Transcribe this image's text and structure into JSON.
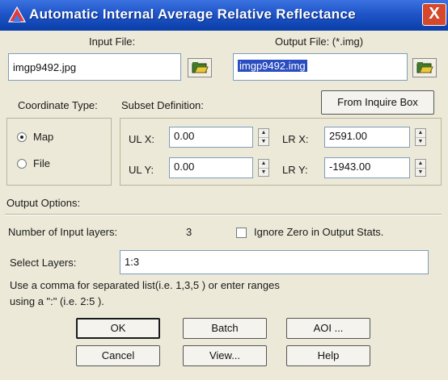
{
  "window": {
    "title": "Automatic Internal Average Relative Reflectance",
    "close_glyph": "X"
  },
  "input_file": {
    "label": "Input File:",
    "value": "imgp9492.jpg"
  },
  "output_file": {
    "label": "Output File: (*.img)",
    "value": "imgp9492.img"
  },
  "coordinate_type": {
    "label": "Coordinate Type:",
    "options": [
      "Map",
      "File"
    ],
    "selected": "Map"
  },
  "subset": {
    "label": "Subset Definition:",
    "from_inquire_box": "From Inquire Box",
    "ulx_label": "UL X:",
    "ulx_value": "0.00",
    "uly_label": "UL Y:",
    "uly_value": "0.00",
    "lrx_label": "LR X:",
    "lrx_value": "2591.00",
    "lry_label": "LR Y:",
    "lry_value": "-1943.00"
  },
  "output_options": {
    "label": "Output Options:",
    "num_layers_label": "Number of Input layers:",
    "num_layers_value": "3",
    "ignore_zero_label": "Ignore Zero in Output Stats.",
    "ignore_zero_checked": false,
    "select_layers_label": "Select Layers:",
    "select_layers_value": "1:3",
    "hint_line1": "Use a comma for separated list(i.e. 1,3,5 ) or enter ranges",
    "hint_line2": "using a \":\" (i.e. 2:5 )."
  },
  "buttons": {
    "ok": "OK",
    "batch": "Batch",
    "aoi": "AOI ...",
    "cancel": "Cancel",
    "view": "View...",
    "help": "Help"
  },
  "colors": {
    "title_bar": "#1f55c8",
    "dialog_bg": "#ece9d8",
    "selection": "#2a4dbf"
  }
}
